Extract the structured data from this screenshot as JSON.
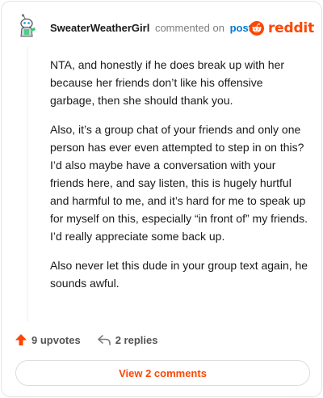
{
  "comment": {
    "username": "SweaterWeatherGirl",
    "commented_text": "commented on",
    "post_link": "post",
    "body": [
      "NTA, and honestly if he does break up with her because her friends don’t like his offensive garbage, then she should thank you.",
      "Also, it’s a group chat of your friends and only one person has ever even attempted to step in on this? I’d also maybe have a conversation with your friends here, and say listen, this is hugely hurtful and harmful to me, and it’s hard for me to speak up for myself on this, especially “in front of” my friends. I’d really appreciate some back up.",
      "Also never let this dude in your group text again, he sounds awful."
    ]
  },
  "brand": {
    "name": "reddit",
    "color": "#ff4500"
  },
  "actions": {
    "upvotes": "9 upvotes",
    "replies": "2 replies"
  },
  "view_button": "View 2 comments",
  "icons": {
    "avatar": "snoo-avatar-icon",
    "upvote": "upvote-arrow-icon",
    "reply": "reply-arrow-icon",
    "logo": "reddit-snoo-icon"
  }
}
